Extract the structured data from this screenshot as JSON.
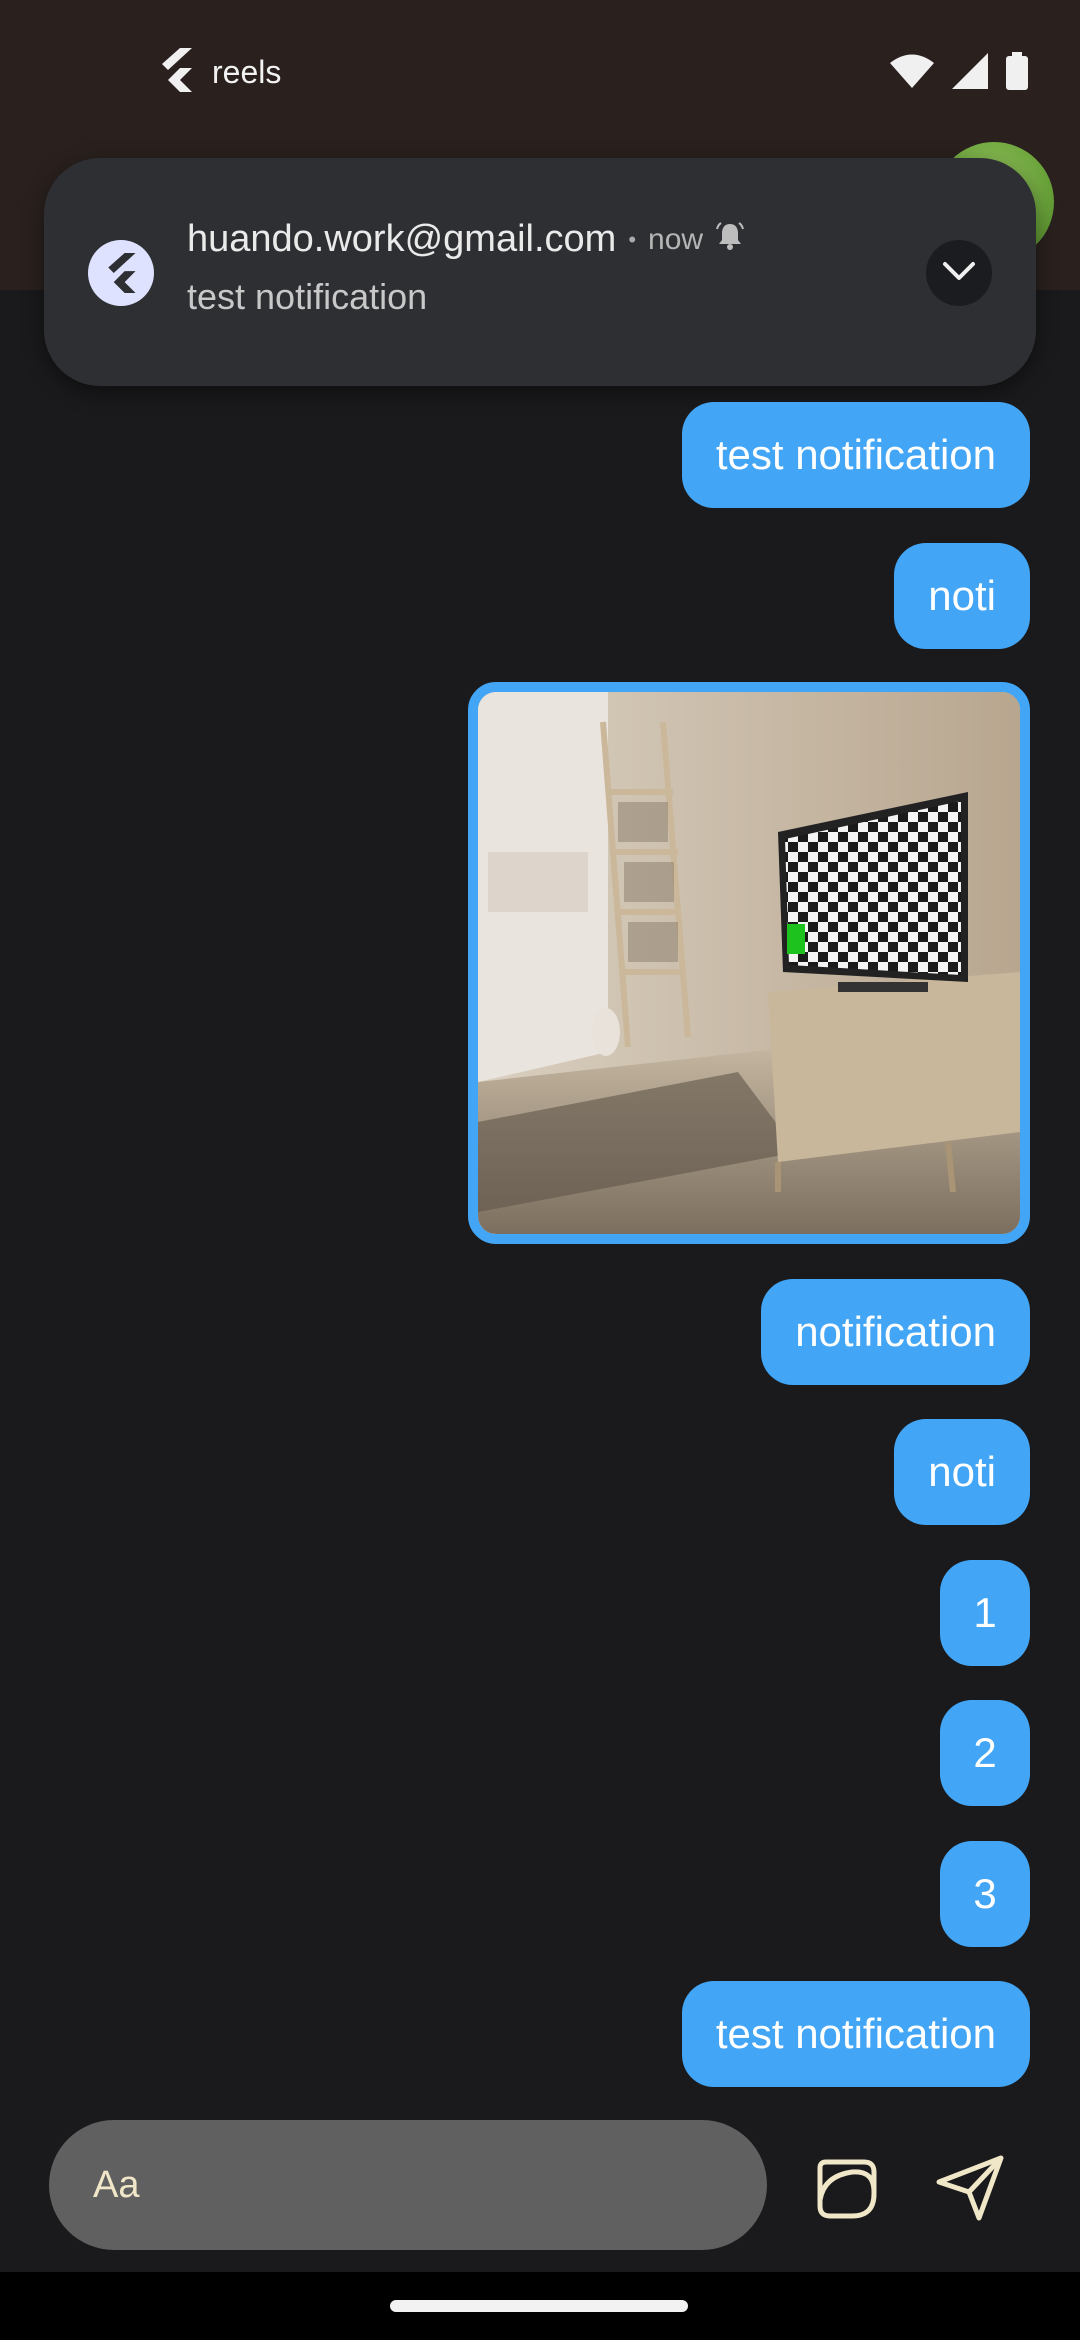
{
  "status_bar": {
    "app_name": "reels"
  },
  "notification": {
    "sender": "huando.work@gmail.com",
    "separator": "•",
    "time": "now",
    "message": "test notification"
  },
  "messages": [
    {
      "text": "test notification"
    },
    {
      "text": "noti"
    },
    {
      "text": "notification"
    },
    {
      "text": "noti"
    },
    {
      "text": "1"
    },
    {
      "text": "2"
    },
    {
      "text": "3"
    },
    {
      "text": "test notification"
    }
  ],
  "composer": {
    "placeholder": "Aa"
  },
  "colors": {
    "bubble": "#42a5f5",
    "background": "#1a1a1c",
    "header": "#2a211e"
  },
  "icons": [
    "flutter-logo-icon",
    "wifi-icon",
    "signal-icon",
    "battery-icon",
    "alert-bell-icon",
    "chevron-down-icon",
    "sticker-icon",
    "send-icon"
  ]
}
